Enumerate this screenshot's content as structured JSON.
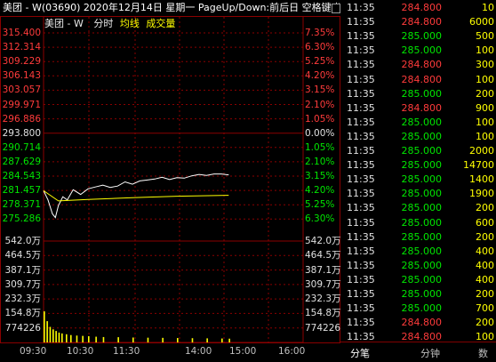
{
  "title_bar": {
    "text": "美团 - W(03690) 2020年12月14日 星期一 PageUp/Down:前后日 空格键:操作"
  },
  "legend": {
    "code": "美团 - W",
    "fenshi": "分时",
    "avg": "均线",
    "vol": "成交量"
  },
  "price_axis": {
    "left": [
      "315.400",
      "312.314",
      "309.229",
      "306.143",
      "303.057",
      "299.971",
      "296.886",
      "293.800",
      "290.714",
      "287.629",
      "284.543",
      "281.457",
      "278.371",
      "275.286"
    ],
    "right": [
      "7.35%",
      "6.30%",
      "5.25%",
      "4.20%",
      "3.15%",
      "2.10%",
      "1.05%",
      "0.00%",
      "1.05%",
      "2.10%",
      "3.15%",
      "4.20%",
      "5.25%",
      "6.30%"
    ]
  },
  "volume_axis": {
    "labels": [
      "542.0万",
      "464.5万",
      "387.1万",
      "309.7万",
      "232.3万",
      "154.8万",
      "774226"
    ]
  },
  "x_axis": {
    "labels": [
      "09:30",
      "10:30",
      "11:30",
      "14:00",
      "15:00",
      "16:00"
    ]
  },
  "colors": {
    "up": "#ff3b3b",
    "down": "#00e600",
    "neutral": "#e0e0e0",
    "price_line": "#ffffff",
    "avg_line": "#ffff00",
    "volume": "#ffff00",
    "grid_red": "#8b0000"
  },
  "chart_data": [
    {
      "type": "line",
      "series": [
        {
          "name": "分时",
          "x": [
            "09:30",
            "09:33",
            "09:36",
            "09:38",
            "09:40",
            "09:43",
            "09:46",
            "09:50",
            "09:55",
            "10:00",
            "10:05",
            "10:10",
            "10:15",
            "10:20",
            "10:25",
            "10:30",
            "10:35",
            "10:40",
            "10:45",
            "10:50",
            "10:55",
            "11:00",
            "11:05",
            "11:10",
            "11:15",
            "11:20",
            "11:25",
            "11:30",
            "11:35"
          ],
          "values": [
            281.4,
            279.4,
            276.4,
            275.6,
            278.2,
            280.1,
            279.4,
            281.6,
            280.6,
            281.8,
            282.2,
            282.6,
            282.1,
            282.4,
            283.3,
            282.8,
            283.5,
            283.7,
            283.9,
            284.3,
            283.8,
            284.2,
            284.1,
            284.6,
            284.9,
            284.7,
            285.0,
            285.0,
            284.8
          ]
        },
        {
          "name": "均线",
          "x": [
            "09:30",
            "09:40",
            "10:00",
            "10:30",
            "11:00",
            "11:35"
          ],
          "values": [
            281.4,
            279.2,
            279.5,
            279.9,
            280.2,
            280.4
          ]
        }
      ],
      "ylim": [
        272.2,
        315.4
      ]
    },
    {
      "type": "bar",
      "series": [
        {
          "name": "成交量",
          "x": [
            "09:30",
            "09:32",
            "09:34",
            "09:36",
            "09:38",
            "09:40",
            "09:42",
            "09:45",
            "09:48",
            "09:52",
            "09:56",
            "10:00",
            "10:05",
            "10:10",
            "10:20",
            "10:30",
            "10:40",
            "10:50",
            "11:00",
            "11:10",
            "11:20",
            "11:30",
            "11:35"
          ],
          "values": [
            1900000,
            1300000,
            950000,
            800000,
            700000,
            600000,
            550000,
            500000,
            450000,
            420000,
            400000,
            380000,
            350000,
            330000,
            320000,
            300000,
            290000,
            280000,
            270000,
            260000,
            250000,
            240000,
            230000
          ]
        }
      ],
      "ylim": [
        0,
        6196000
      ]
    }
  ],
  "ticks": [
    {
      "time": "11:35",
      "price": "284.800",
      "vol": "10",
      "color": "red"
    },
    {
      "time": "11:35",
      "price": "284.800",
      "vol": "6000",
      "color": "red"
    },
    {
      "time": "11:35",
      "price": "285.000",
      "vol": "500",
      "color": "grn"
    },
    {
      "time": "11:35",
      "price": "285.000",
      "vol": "100",
      "color": "grn"
    },
    {
      "time": "11:35",
      "price": "284.800",
      "vol": "300",
      "color": "red"
    },
    {
      "time": "11:35",
      "price": "284.800",
      "vol": "100",
      "color": "red"
    },
    {
      "time": "11:35",
      "price": "285.000",
      "vol": "200",
      "color": "grn"
    },
    {
      "time": "11:35",
      "price": "284.800",
      "vol": "900",
      "color": "red"
    },
    {
      "time": "11:35",
      "price": "285.000",
      "vol": "100",
      "color": "grn"
    },
    {
      "time": "11:35",
      "price": "285.000",
      "vol": "100",
      "color": "grn"
    },
    {
      "time": "11:35",
      "price": "285.000",
      "vol": "2000",
      "color": "grn"
    },
    {
      "time": "11:35",
      "price": "285.000",
      "vol": "14700",
      "color": "grn"
    },
    {
      "time": "11:35",
      "price": "285.000",
      "vol": "1400",
      "color": "grn"
    },
    {
      "time": "11:35",
      "price": "285.000",
      "vol": "1900",
      "color": "grn"
    },
    {
      "time": "11:35",
      "price": "285.000",
      "vol": "200",
      "color": "grn"
    },
    {
      "time": "11:35",
      "price": "285.000",
      "vol": "600",
      "color": "grn"
    },
    {
      "time": "11:35",
      "price": "285.000",
      "vol": "200",
      "color": "grn"
    },
    {
      "time": "11:35",
      "price": "285.000",
      "vol": "400",
      "color": "grn"
    },
    {
      "time": "11:35",
      "price": "285.000",
      "vol": "400",
      "color": "grn"
    },
    {
      "time": "11:35",
      "price": "285.000",
      "vol": "400",
      "color": "grn"
    },
    {
      "time": "11:35",
      "price": "285.000",
      "vol": "200",
      "color": "grn"
    },
    {
      "time": "11:35",
      "price": "285.000",
      "vol": "700",
      "color": "grn"
    },
    {
      "time": "11:35",
      "price": "284.800",
      "vol": "200",
      "color": "red"
    },
    {
      "time": "11:35",
      "price": "284.800",
      "vol": "100",
      "color": "red"
    }
  ],
  "tabs": [
    "分笔",
    "分钟",
    "数值"
  ]
}
